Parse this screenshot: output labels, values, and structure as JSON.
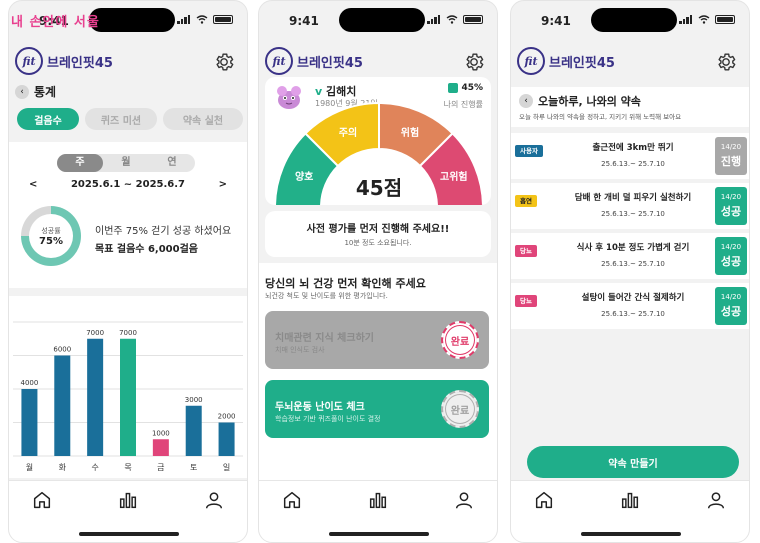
{
  "watermark": "내 손안에 서울",
  "status_time": "9:41",
  "app_name": "브레인핏45",
  "logo_mark": "fit",
  "screen1": {
    "back_title": "통계",
    "tabs": [
      "걸음수",
      "퀴즈 미션",
      "약속 실천"
    ],
    "period_tabs": [
      "주",
      "월",
      "연"
    ],
    "prev": "<",
    "next": ">",
    "date_range": "2025.6.1 ~ 2025.6.7",
    "donut_label": "성공률",
    "donut_value": "75%",
    "success_rate": 0.75,
    "message": "이번주 75% 걷기 성공 하셨어요",
    "goal": "목표 걸음수 6,000걸음"
  },
  "chart_data": {
    "type": "bar",
    "categories": [
      "월",
      "화",
      "수",
      "목",
      "금",
      "토",
      "일"
    ],
    "values": [
      4000,
      6000,
      7000,
      7000,
      1000,
      3000,
      2000
    ],
    "data_labels": [
      "4000",
      "6000",
      "7000",
      "7000",
      "1000",
      "3000",
      "2000"
    ],
    "ylim": [
      0,
      8000
    ],
    "grid": true,
    "colors": [
      "#1a6f9a",
      "#1a6f9a",
      "#1a6f9a",
      "#1fae8a",
      "#e0457a",
      "#1a6f9a",
      "#1a6f9a"
    ]
  },
  "screen2": {
    "user_name": "김해치",
    "birth": "1980년 9월 21일",
    "progress": "45%",
    "progress_label": "나의 진행률",
    "gauge_labels": [
      "양호",
      "주의",
      "위험",
      "고위험"
    ],
    "gauge_colors": [
      "#22b089",
      "#f3c317",
      "#e0845a",
      "#dd4a72"
    ],
    "score": "45점",
    "notice_title": "사전 평가를 먼저 진행해 주세요!!",
    "notice_sub": "10분 정도 소요됩니다.",
    "section_title": "당신의 뇌 건강 먼저 확인해 주세요",
    "section_sub": "뇌건강 척도 및 난이도를 위한 평가입니다.",
    "items": [
      {
        "title": "치매관련 지식 체크하기",
        "sub": "치매 인식도 검사",
        "stamp": "완료"
      },
      {
        "title": "두뇌운동 난이도 체크",
        "sub": "학습정보 기반 퀴즈풀이 난이도 결정",
        "stamp": "완료"
      }
    ]
  },
  "screen3": {
    "title": "오늘하루, 나와의 약속",
    "subtitle": "오늘 하루 나와의 약속을 정하고, 지키기 위해 노력해 보아요",
    "promises": [
      {
        "badge": "사용자",
        "badge_bg": "#1a6f9a",
        "badge_fg": "#ffffff",
        "title": "출근전에 3km만 뛰기",
        "date": "25.6.13.~ 25.7.10",
        "count": "14/20",
        "status": "진행",
        "status_bg": "#a8a8a8"
      },
      {
        "badge": "흡연",
        "badge_bg": "#f3c317",
        "badge_fg": "#222222",
        "title": "담배 한 개비 덜 피우기 실천하기",
        "date": "25.6.13.~ 25.7.10",
        "count": "14/20",
        "status": "성공",
        "status_bg": "#1fae8a"
      },
      {
        "badge": "당뇨",
        "badge_bg": "#e0457a",
        "badge_fg": "#ffffff",
        "title": "식사 후 10분 정도 가볍게 걷기",
        "date": "25.6.13.~ 25.7.10",
        "count": "14/20",
        "status": "성공",
        "status_bg": "#1fae8a"
      },
      {
        "badge": "당뇨",
        "badge_bg": "#e0457a",
        "badge_fg": "#ffffff",
        "title": "설탕이 들어간 간식 절제하기",
        "date": "25.6.13.~ 25.7.10",
        "count": "14/20",
        "status": "성공",
        "status_bg": "#1fae8a"
      }
    ],
    "make_button": "약속 만들기"
  },
  "icons": [
    "home-icon",
    "chart-icon",
    "profile-icon",
    "gear-icon",
    "back-icon",
    "bars-icon"
  ]
}
